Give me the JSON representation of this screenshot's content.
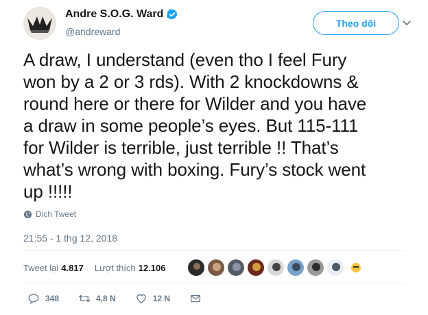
{
  "author": {
    "display_name": "Andre S.O.G. Ward",
    "handle": "@andreward",
    "verified": true,
    "avatar_icon": "crown-logo-avatar"
  },
  "follow_button": {
    "label": "Theo dõi",
    "color": "#1da1f2"
  },
  "tweet": {
    "lines": [
      "A draw, I understand (even tho I feel Fury",
      "won by a 2 or 3 rds). With 2 knockdowns &",
      "round here or there for Wilder and you have",
      "a draw in some people’s eyes. But 115-111",
      "for Wilder is terrible, just terrible !! That’s",
      "what’s wrong with boxing. Fury’s stock went",
      "up !!!!!"
    ],
    "translate_label": "Dịch Tweet",
    "timestamp": "21:55 - 1 thg 12, 2018"
  },
  "stats": {
    "retweets_label": "Tweet lại",
    "retweets_value": "4.817",
    "likes_label": "Lượt thích",
    "likes_value": "12.106"
  },
  "likers": [
    "liker-1",
    "liker-2",
    "liker-3",
    "liker-4",
    "liker-5",
    "liker-6",
    "liker-7",
    "liker-8",
    "liker-9"
  ],
  "actions": {
    "reply_count": "348",
    "retweet_count": "4,8 N",
    "like_count": "12 N"
  }
}
